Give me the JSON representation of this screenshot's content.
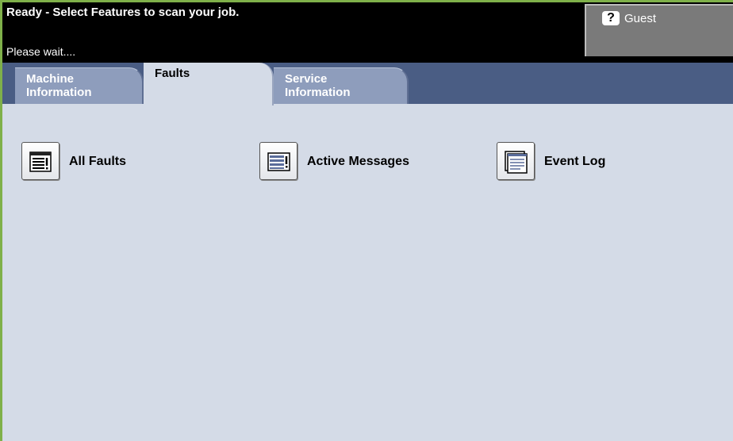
{
  "status": {
    "message": "Ready - Select Features to scan your job.",
    "sub_message": "Please wait...."
  },
  "user": {
    "icon": "question-mark-icon",
    "label": "Guest"
  },
  "tabs": [
    {
      "label_line1": "Machine",
      "label_line2": "Information",
      "active": false
    },
    {
      "label_line1": "Faults",
      "label_line2": "",
      "active": true
    },
    {
      "label_line1": "Service",
      "label_line2": "Information",
      "active": false
    }
  ],
  "features": [
    {
      "label": "All Faults",
      "icon": "fault-list-icon"
    },
    {
      "label": "Active Messages",
      "icon": "messages-list-icon"
    },
    {
      "label": "Event Log",
      "icon": "event-log-icon"
    }
  ],
  "colors": {
    "frame_border": "#7fb04a",
    "status_bar": "#000000",
    "tab_bar": "#4a5d84",
    "tab_inactive": "#8e9dbc",
    "content_bg": "#d4dbe7",
    "guest_button": "#7a7a7a"
  }
}
